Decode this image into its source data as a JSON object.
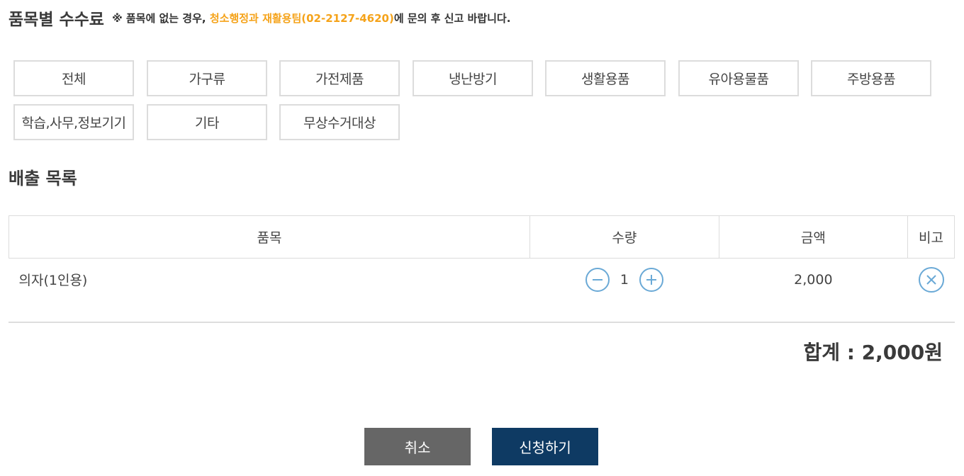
{
  "header": {
    "title": "품목별 수수료",
    "notice_prefix": "※ 품목에 없는 경우, ",
    "notice_contact": "청소행정과 재활용팀(02-2127-4620)",
    "notice_suffix": "에 문의 후 신고 바랍니다."
  },
  "categories": [
    "전체",
    "가구류",
    "가전제품",
    "냉난방기",
    "생활용품",
    "유아용물품",
    "주방용품",
    "학습,사무,정보기기",
    "기타",
    "무상수거대상"
  ],
  "list_section": {
    "title": "배출 목록"
  },
  "table": {
    "headers": {
      "item": "품목",
      "quantity": "수량",
      "amount": "금액",
      "note": "비고"
    },
    "rows": [
      {
        "item": "의자(1인용)",
        "quantity": "1",
        "amount": "2,000"
      }
    ]
  },
  "total": {
    "text": "합계 : 2,000원"
  },
  "buttons": {
    "cancel": "취소",
    "submit": "신청하기"
  },
  "colors": {
    "accent_orange": "#f5a31a",
    "icon_blue": "#6aa9d6",
    "submit_navy": "#0e3a63",
    "cancel_gray": "#666666"
  },
  "icons": {
    "minus": "minus-circle-icon",
    "plus": "plus-circle-icon",
    "remove": "close-circle-icon"
  }
}
